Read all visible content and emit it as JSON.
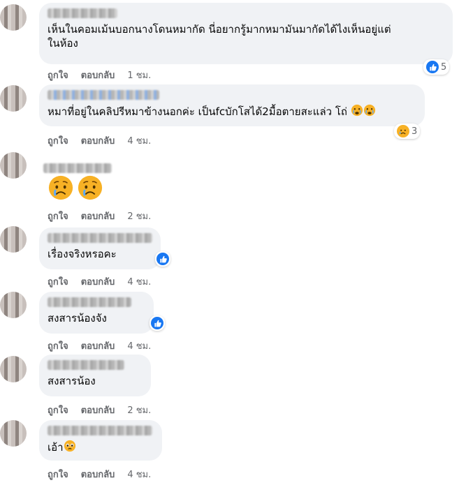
{
  "actions": {
    "like": "ถูกใจ",
    "reply": "ตอบกลับ"
  },
  "colors": {
    "like_blue": "#1877f2",
    "bubble": "#f0f2f5",
    "muted": "#65676b",
    "sad_yellow": "#f7b125"
  },
  "comments": [
    {
      "text_line1": "เห็นในคอมเม้นบอกนางโดนหมากัด นี่อยากรู้มากหมามันมากัดได้ไงเห็นอยู่แต่",
      "text_line2": "ในห้อง",
      "time": "1 ชม.",
      "reaction_icon": "like-icon",
      "reaction_count": "5"
    },
    {
      "text": "หมาที่อยู่ในคลิปรีหมาข้างนอกค่ะ เป็นfcบักโสได้2มื้อตายสะแล่ว โถ่",
      "time": "4 ชม.",
      "reaction_icon": "sad-icon",
      "reaction_count": "3"
    },
    {
      "text": "",
      "time": "2 ชม.",
      "emoji": "sad-face-icon"
    },
    {
      "text": "เรื่องจริงหรอคะ",
      "time": "4 ชม.",
      "reaction_icon": "like-icon"
    },
    {
      "text": "สงสารน้องจัง",
      "time": "4 ชม.",
      "reaction_icon": "like-icon"
    },
    {
      "text": "สงสารน้อง",
      "time": "2 ชม."
    },
    {
      "text": "เอ้า",
      "time": "4 ชม.",
      "emoji": "pleading-face-icon"
    }
  ]
}
